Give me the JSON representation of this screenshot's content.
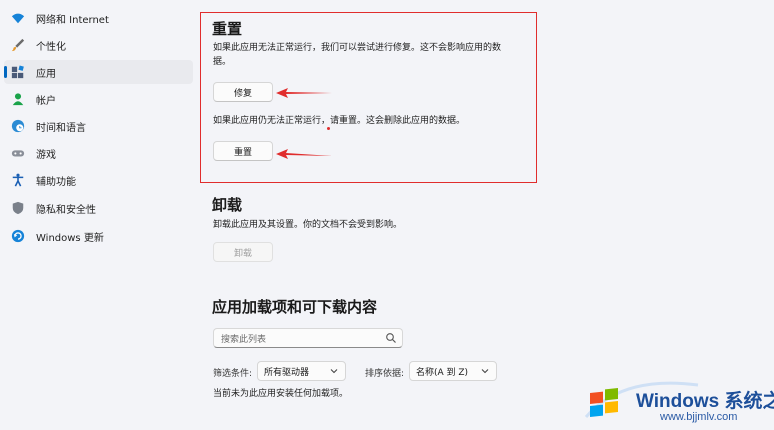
{
  "sidebar": {
    "items": [
      {
        "label": "网络和 Internet",
        "icon": "wifi-icon"
      },
      {
        "label": "个性化",
        "icon": "brush-icon"
      },
      {
        "label": "应用",
        "icon": "apps-icon",
        "active": true
      },
      {
        "label": "帐户",
        "icon": "person-icon"
      },
      {
        "label": "时间和语言",
        "icon": "globe-clock-icon"
      },
      {
        "label": "游戏",
        "icon": "gamepad-icon"
      },
      {
        "label": "辅助功能",
        "icon": "accessibility-icon"
      },
      {
        "label": "隐私和安全性",
        "icon": "shield-icon"
      },
      {
        "label": "Windows 更新",
        "icon": "update-icon"
      }
    ]
  },
  "reset_section": {
    "title": "重置",
    "repair_desc_line1": "如果此应用无法正常运行，我们可以尝试进行修复。这不会影响应用的数",
    "repair_desc_line2": "据。",
    "repair_button": "修复",
    "reset_desc": "如果此应用仍无法正常运行，请重置。这会删除此应用的数据。",
    "reset_button": "重置"
  },
  "uninstall_section": {
    "title": "卸载",
    "desc": "卸载此应用及其设置。你的文档不会受到影响。",
    "button": "卸载"
  },
  "addons_section": {
    "title": "应用加载项和可下载内容",
    "search_placeholder": "搜索此列表",
    "filter_label": "筛选条件:",
    "filter_value": "所有驱动器",
    "sort_label": "排序依据:",
    "sort_value": "名称(A 到 Z)",
    "empty_message": "当前未为此应用安装任何加载项。"
  },
  "watermark": {
    "title": "Windows 系统之家",
    "url": "www.bjjmlv.com"
  },
  "colors": {
    "accent": "#0067c0",
    "highlight_box": "#e02d2d"
  }
}
